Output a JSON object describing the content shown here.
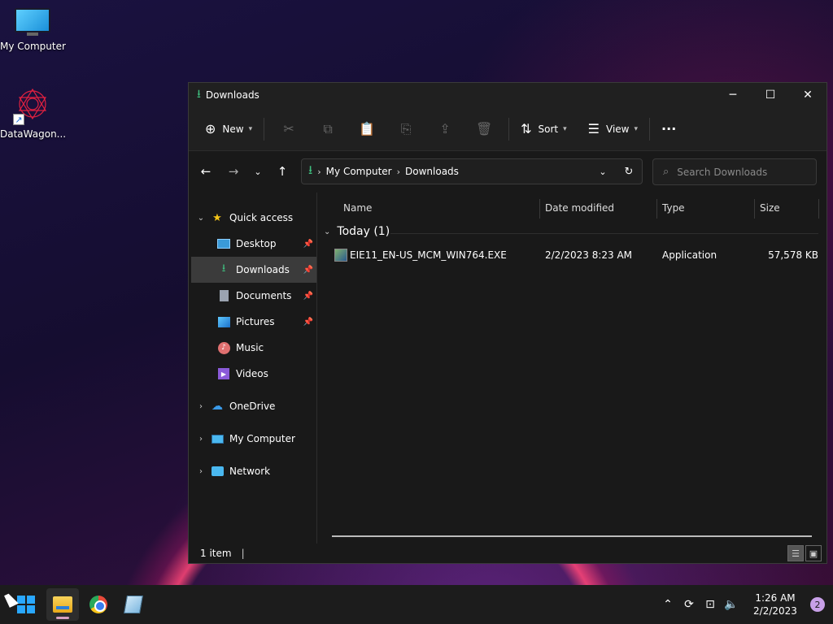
{
  "desktop": {
    "icons": [
      {
        "label": "My Computer",
        "icon": "monitor-icon"
      },
      {
        "label": "DataWagon...",
        "icon": "datawagon-logo-icon"
      }
    ]
  },
  "window": {
    "title": "Downloads",
    "controls": {
      "minimize": "─",
      "maximize": "☐",
      "close": "✕"
    },
    "commandbar": {
      "new_label": "New",
      "sort_label": "Sort",
      "view_label": "View",
      "more_label": "···"
    },
    "address": {
      "crumbs": [
        "My Computer",
        "Downloads"
      ]
    },
    "search": {
      "placeholder": "Search Downloads"
    },
    "navpane": {
      "quick_access": "Quick access",
      "items": [
        {
          "label": "Desktop",
          "pinned": true
        },
        {
          "label": "Downloads",
          "pinned": true,
          "selected": true
        },
        {
          "label": "Documents",
          "pinned": true
        },
        {
          "label": "Pictures",
          "pinned": true
        },
        {
          "label": "Music",
          "pinned": false
        },
        {
          "label": "Videos",
          "pinned": false
        }
      ],
      "roots": [
        "OneDrive",
        "My Computer",
        "Network"
      ]
    },
    "columns": {
      "name": "Name",
      "date": "Date modified",
      "type": "Type",
      "size": "Size"
    },
    "group": {
      "label": "Today (1)"
    },
    "files": [
      {
        "name": "EIE11_EN-US_MCM_WIN764.EXE",
        "date": "2/2/2023 8:23 AM",
        "type": "Application",
        "size": "57,578 KB"
      }
    ],
    "status": {
      "count": "1 item",
      "caret": "|"
    }
  },
  "taskbar": {
    "clock_time": "1:26 AM",
    "clock_date": "2/2/2023",
    "notifications": "2"
  },
  "colors": {
    "accent": "#3fbf7f",
    "selection": "#3b3b3b",
    "taskbar": "#1c1c1c"
  }
}
